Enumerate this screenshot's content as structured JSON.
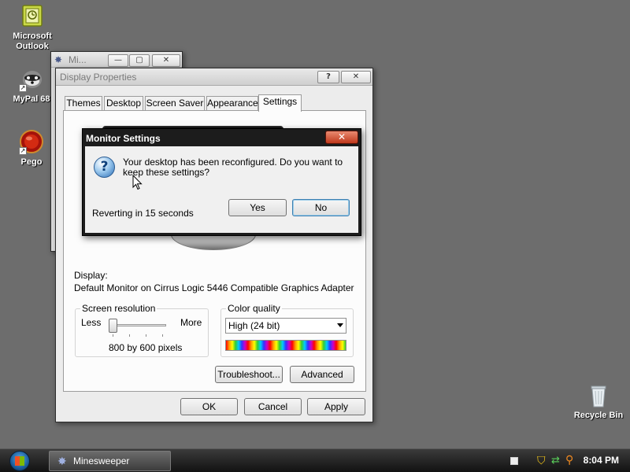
{
  "desktop": {
    "icons": [
      {
        "label": "Microsoft\nOutlook",
        "line1": "Microsoft",
        "line2": "Outlook",
        "icon": "outlook-icon"
      },
      {
        "label": "MyPal 68",
        "icon": "mypal-icon"
      },
      {
        "label": "Pego",
        "icon": "pego-icon"
      },
      {
        "label": "Recycle Bin",
        "icon": "recycle-bin-icon"
      }
    ]
  },
  "background_window": {
    "title": "Mi..."
  },
  "display_properties": {
    "title": "Display Properties",
    "help_label": "?",
    "close_label": "✕",
    "tabs": [
      "Themes",
      "Desktop",
      "Screen Saver",
      "Appearance",
      "Settings"
    ],
    "active_tab": "Settings",
    "display_label": "Display:",
    "display_value": "Default Monitor on Cirrus Logic 5446 Compatible Graphics Adapter",
    "screen_resolution": {
      "legend": "Screen resolution",
      "less": "Less",
      "more": "More",
      "value": "800 by 600 pixels",
      "slider_position": 0
    },
    "color_quality": {
      "legend": "Color quality",
      "selected": "High (24 bit)"
    },
    "troubleshoot_label": "Troubleshoot...",
    "advanced_label": "Advanced",
    "ok_label": "OK",
    "cancel_label": "Cancel",
    "apply_label": "Apply"
  },
  "monitor_dialog": {
    "title": "Monitor Settings",
    "close_label": "✕",
    "message": "Your desktop has been reconfigured.  Do you want to keep these settings?",
    "countdown": "Reverting in 15 seconds",
    "yes_label": "Yes",
    "no_label": "No"
  },
  "taskbar": {
    "task_label": "Minesweeper",
    "clock": "8:04 PM"
  },
  "colors": {
    "desktop": "#6d6d6d",
    "dialog_frame": "#1c1c1c",
    "close_button": "#c0391c",
    "taskbar": "#121212"
  }
}
